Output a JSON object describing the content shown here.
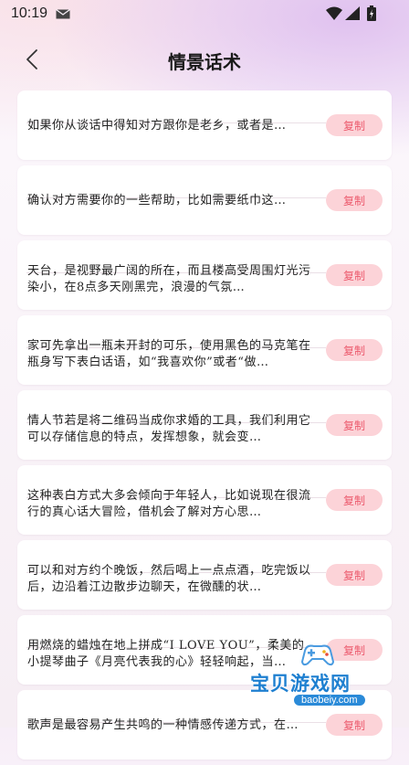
{
  "status_bar": {
    "time": "10:19"
  },
  "header": {
    "title": "情景话术"
  },
  "copy_label": "复制",
  "items": [
    {
      "text": "如果你从谈话中得知对方跟你是老乡，或者是…"
    },
    {
      "text": "确认对方需要你的一些帮助，比如需要纸巾这…"
    },
    {
      "text": "天台，是视野最广阔的所在，而且楼高受周围灯光污染小，在8点多天刚黑完，浪漫的气氛…"
    },
    {
      "text": "家可先拿出一瓶未开封的可乐，使用黑色的马克笔在瓶身写下表白话语，如“我喜欢你”或者“做…"
    },
    {
      "text": "情人节若是将二维码当成你求婚的工具，我们利用它可以存储信息的特点，发挥想象，就会变…"
    },
    {
      "text": "这种表白方式大多会倾向于年轻人，比如说现在很流行的真心话大冒险，借机会了解对方心思…"
    },
    {
      "text": "可以和对方约个晚饭，然后喝上一点点酒，吃完饭以后，边沿着江边散步边聊天，在微醺的状…"
    },
    {
      "text": "用燃烧的蜡烛在地上拼成“I LOVE YOU”，柔美的小提琴曲子《月亮代表我的心》轻轻响起，当…"
    },
    {
      "text": "歌声是最容易产生共鸣的一种情感传递方式，在…"
    }
  ],
  "watermark": {
    "name": "宝贝游戏网",
    "url": "baobeiy.com"
  }
}
